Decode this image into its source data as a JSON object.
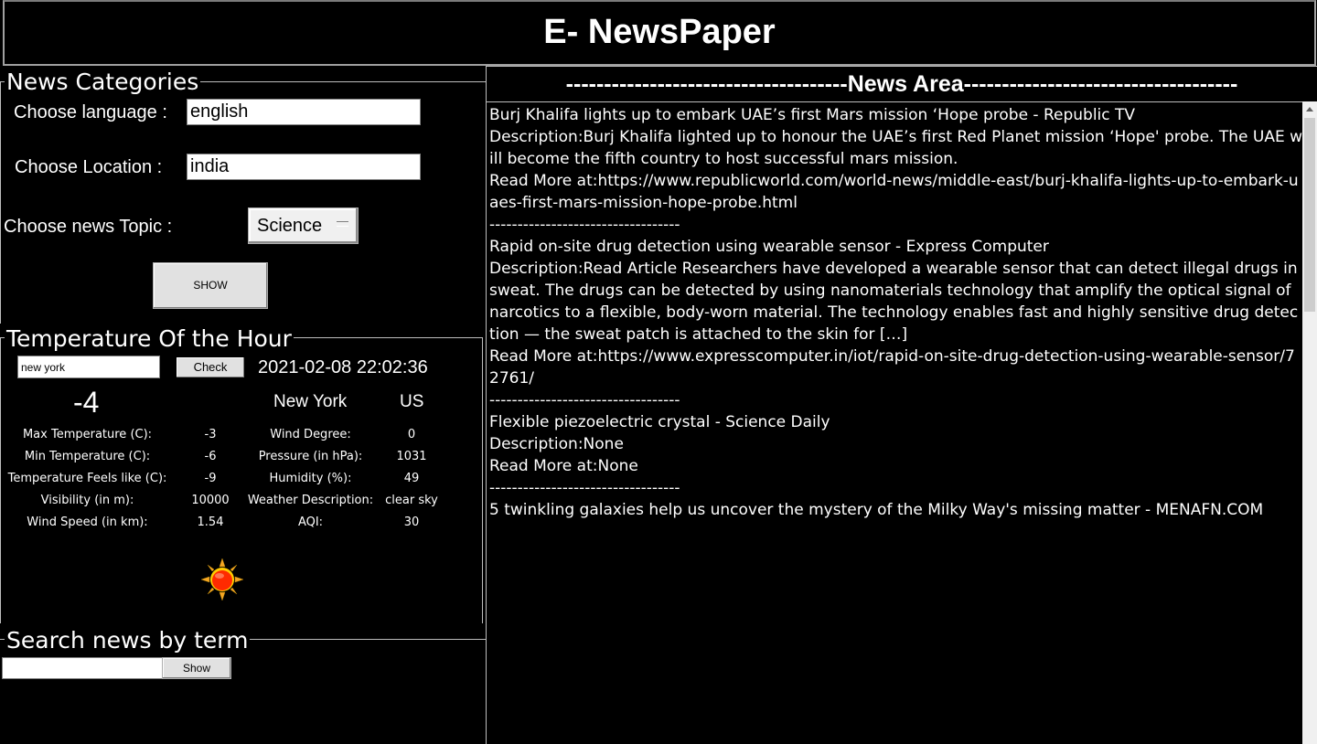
{
  "app": {
    "title": "E- NewsPaper"
  },
  "categories": {
    "legend": "News Categories",
    "language_label": "Choose language :",
    "language_value": "english",
    "location_label": "Choose Location :",
    "location_value": "india",
    "topic_label": "Choose news Topic :",
    "topic_value": "Science",
    "show_label": "SHOW"
  },
  "temperature": {
    "legend": "Temperature Of the Hour",
    "city_input": "new york",
    "check_label": "Check",
    "datetime": "2021-02-08 22:02:36",
    "current_temp": "-4",
    "city": "New York",
    "country": "US",
    "rows": [
      {
        "label": "Max Temperature (C):",
        "value": "-3",
        "label2": "Wind Degree:",
        "value2": "0"
      },
      {
        "label": "Min Temperature (C):",
        "value": "-6",
        "label2": "Pressure (in hPa):",
        "value2": "1031"
      },
      {
        "label": "Temperature Feels like (C):",
        "value": "-9",
        "label2": "Humidity (%):",
        "value2": "49"
      },
      {
        "label": "Visibility (in m):",
        "value": "10000",
        "label2": "Weather Description:",
        "value2": "clear sky"
      },
      {
        "label": "Wind Speed (in km):",
        "value": "1.54",
        "label2": "AQI:",
        "value2": "30"
      }
    ],
    "weather_icon": "sun-icon"
  },
  "search": {
    "legend": "Search news by term",
    "input_value": "",
    "show_label": "Show"
  },
  "news": {
    "header": "-------------------------------------News Area------------------------------------",
    "lines": [
      "Burj Khalifa lights up to embark UAE’s first Mars mission ‘Hope probe - Republic TV",
      "",
      "Description:Burj Khalifa lighted up to honour the UAE’s first Red Planet mission ‘Hope' probe. The UAE will become the fifth country to host successful mars mission.",
      "",
      "Read More at:https://www.republicworld.com/world-news/middle-east/burj-khalifa-lights-up-to-embark-uaes-first-mars-mission-hope-probe.html",
      "",
      "----------------------------------",
      "Rapid on-site drug detection using wearable sensor - Express Computer",
      "",
      "Description:Read Article Researchers have developed a wearable sensor that can detect illegal drugs in sweat. The drugs can be detected by using nanomaterials technology that amplify the optical signal of narcotics to a flexible, body-worn material. The technology enables fast and highly sensitive drug detection — the sweat patch is attached to the skin for […]",
      "",
      "Read More at:https://www.expresscomputer.in/iot/rapid-on-site-drug-detection-using-wearable-sensor/72761/",
      "",
      "----------------------------------",
      "Flexible piezoelectric crystal - Science Daily",
      "",
      "Description:None",
      "",
      "Read More at:None",
      "",
      "----------------------------------",
      "5 twinkling galaxies help us uncover the mystery of the Milky Way's missing matter - MENAFN.COM"
    ]
  },
  "colors": {
    "background": "#000000",
    "text": "#ffffff",
    "frame": "#bdbdbd"
  }
}
